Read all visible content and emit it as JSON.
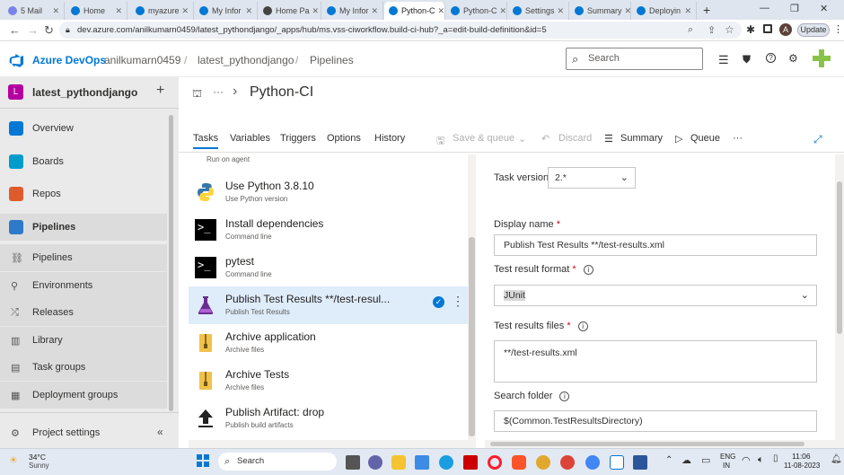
{
  "browser_tabs": [
    {
      "label": "5 Mail",
      "color": "#7b83eb"
    },
    {
      "label": "Home",
      "color": "#0078d4"
    },
    {
      "label": "myazure",
      "color": "#0078d4"
    },
    {
      "label": "My Infor",
      "color": "#0078d4"
    },
    {
      "label": "Home Pa",
      "color": "#444444"
    },
    {
      "label": "My Infor",
      "color": "#0078d4"
    },
    {
      "label": "Python-C",
      "color": "#0078d4"
    },
    {
      "label": "Python-C",
      "color": "#0078d4"
    },
    {
      "label": "Settings",
      "color": "#0078d4"
    },
    {
      "label": "Summary",
      "color": "#0078d4"
    },
    {
      "label": "Deployin",
      "color": "#0078d4"
    }
  ],
  "new_tab": "+",
  "url": "dev.azure.com/anilkumarn0459/latest_pythondjango/_apps/hub/ms.vss-ciworkflow.build-ci-hub?_a=edit-build-definition&id=5",
  "update_button": "Update",
  "profile_initial": "A",
  "header": {
    "product": "Azure DevOps",
    "org": "anilkumarn0459",
    "sep": "/",
    "project": "latest_pythondjango",
    "section": "Pipelines",
    "search_placeholder": "Search"
  },
  "project": {
    "initial": "L",
    "name": "latest_pythondjango",
    "add": "+"
  },
  "nav": [
    {
      "label": "Overview",
      "color": "#0078d4"
    },
    {
      "label": "Boards",
      "color": "#009ccc"
    },
    {
      "label": "Repos",
      "color": "#e05b2b"
    },
    {
      "label": "Pipelines",
      "color": "#2d7ac8"
    }
  ],
  "subnav": [
    "Pipelines",
    "Environments",
    "Releases",
    "Library",
    "Task groups",
    "Deployment groups"
  ],
  "project_settings": "Project settings",
  "collapse": "«",
  "breadcrumb_more": "···",
  "breadcrumb_chevron": "›",
  "pipeline_title": "Python-CI",
  "edit_tabs": [
    "Tasks",
    "Variables",
    "Triggers",
    "Options",
    "History"
  ],
  "toolbar": {
    "save": "Save & queue",
    "discard": "Discard",
    "summary": "Summary",
    "queue": "Queue",
    "more": "···"
  },
  "run_on_agent": "Run on agent",
  "tasks": [
    {
      "name": "Use Python 3.8.10",
      "sub": "Use Python version",
      "icon": "python"
    },
    {
      "name": "Install dependencies",
      "sub": "Command line",
      "icon": "cmd"
    },
    {
      "name": "pytest",
      "sub": "Command line",
      "icon": "cmd"
    },
    {
      "name": "Publish Test Results **/test-resul...",
      "sub": "Publish Test Results",
      "icon": "flask"
    },
    {
      "name": "Archive application",
      "sub": "Archive files",
      "icon": "zip"
    },
    {
      "name": "Archive Tests",
      "sub": "Archive files",
      "icon": "zip"
    },
    {
      "name": "Publish Artifact: drop",
      "sub": "Publish build artifacts",
      "icon": "upload"
    }
  ],
  "form": {
    "task_version_label": "Task version",
    "task_version_value": "2.*",
    "display_name_label": "Display name",
    "display_name_value": "Publish Test Results **/test-results.xml",
    "format_label": "Test result format",
    "format_value": "JUnit",
    "files_label": "Test results files",
    "files_value": "**/test-results.xml",
    "search_label": "Search folder",
    "search_value": "$(Common.TestResultsDirectory)",
    "required": "*"
  },
  "taskbar": {
    "temp": "34°C",
    "weather": "Sunny",
    "search": "Search",
    "lang1": "ENG",
    "lang2": "IN",
    "time": "11:06",
    "date": "11-08-2023"
  }
}
